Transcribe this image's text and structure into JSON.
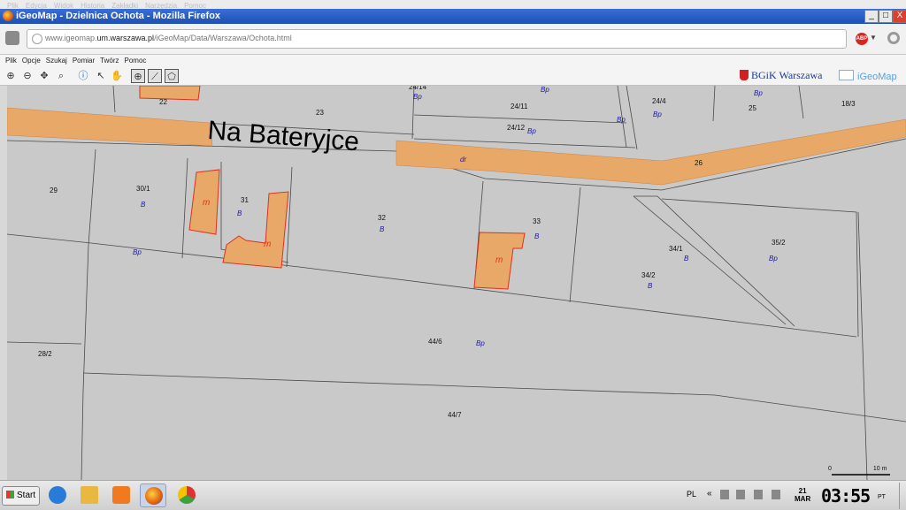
{
  "browser": {
    "menu_items": [
      "Plik",
      "Edycja",
      "Widok",
      "Historia",
      "Zakładki",
      "Narzędzia",
      "Pomoc"
    ],
    "window_title": "iGeoMap - Dzielnica Ochota - Mozilla Firefox",
    "window_buttons": {
      "minimize": "_",
      "maximize": "□",
      "close": "X"
    },
    "url_prefix": "www.igeomap.",
    "url_domain": "um.warszawa.pl",
    "url_path": "/iGeoMap/Data/Warszawa/Ochota.html",
    "abp_label": "ABP"
  },
  "app_menu": [
    "Plik",
    "Opcje",
    "Szukaj",
    "Pomiar",
    "Twórz",
    "Pomoc"
  ],
  "toolbar_icons": [
    "zoom-in-icon",
    "zoom-out-icon",
    "pan-icon",
    "zoom-window-icon",
    "info-icon",
    "pointer-icon",
    "hand-icon",
    "target-icon",
    "polyline-icon",
    "polygon-icon"
  ],
  "logos": {
    "bgik": "BGiK Warszawa",
    "igeomap": "iGeoMap"
  },
  "map": {
    "street_name": "Na Bateryjce",
    "street_use": "dr",
    "parcels": [
      {
        "id": "24/14",
        "use": "Bp"
      },
      {
        "id": "22",
        "use": ""
      },
      {
        "id": "23",
        "use": ""
      },
      {
        "id": "24/11",
        "use": "Bp"
      },
      {
        "id": "24/12",
        "use": "Bp"
      },
      {
        "id": "24/4",
        "use": "Bp"
      },
      {
        "id": "25",
        "use": "Bp"
      },
      {
        "id": "18/3",
        "use": ""
      },
      {
        "id": "26",
        "use": ""
      },
      {
        "id": "29",
        "use": ""
      },
      {
        "id": "30/1",
        "use": "B"
      },
      {
        "id": "31",
        "use": "B"
      },
      {
        "id": "32",
        "use": "B"
      },
      {
        "id": "33",
        "use": "B"
      },
      {
        "id": "34/1",
        "use": "B"
      },
      {
        "id": "34/2",
        "use": "B"
      },
      {
        "id": "35/2",
        "use": "Bp"
      },
      {
        "id": "44/6",
        "use": "Bp"
      },
      {
        "id": "28/2",
        "use": ""
      },
      {
        "id": "44/7",
        "use": ""
      }
    ],
    "building_label": "m",
    "extra_use_label": "Bp",
    "scale": {
      "start": "0",
      "end": "10 m"
    }
  },
  "taskbar": {
    "start_label": "Start",
    "apps": [
      {
        "name": "internet-explorer-icon",
        "color": "#2a7ad8",
        "active": false
      },
      {
        "name": "file-explorer-icon",
        "color": "#e8b840",
        "active": false
      },
      {
        "name": "media-player-icon",
        "color": "#f07a20",
        "active": false
      },
      {
        "name": "firefox-icon",
        "color": "#e06010",
        "active": true
      },
      {
        "name": "chrome-icon",
        "color": "#3aa040",
        "active": false
      }
    ],
    "language": "PL",
    "tray_arrow": "«",
    "date_day": "21",
    "date_month": "MAR",
    "time": "03:55",
    "time_zone": "PT"
  }
}
